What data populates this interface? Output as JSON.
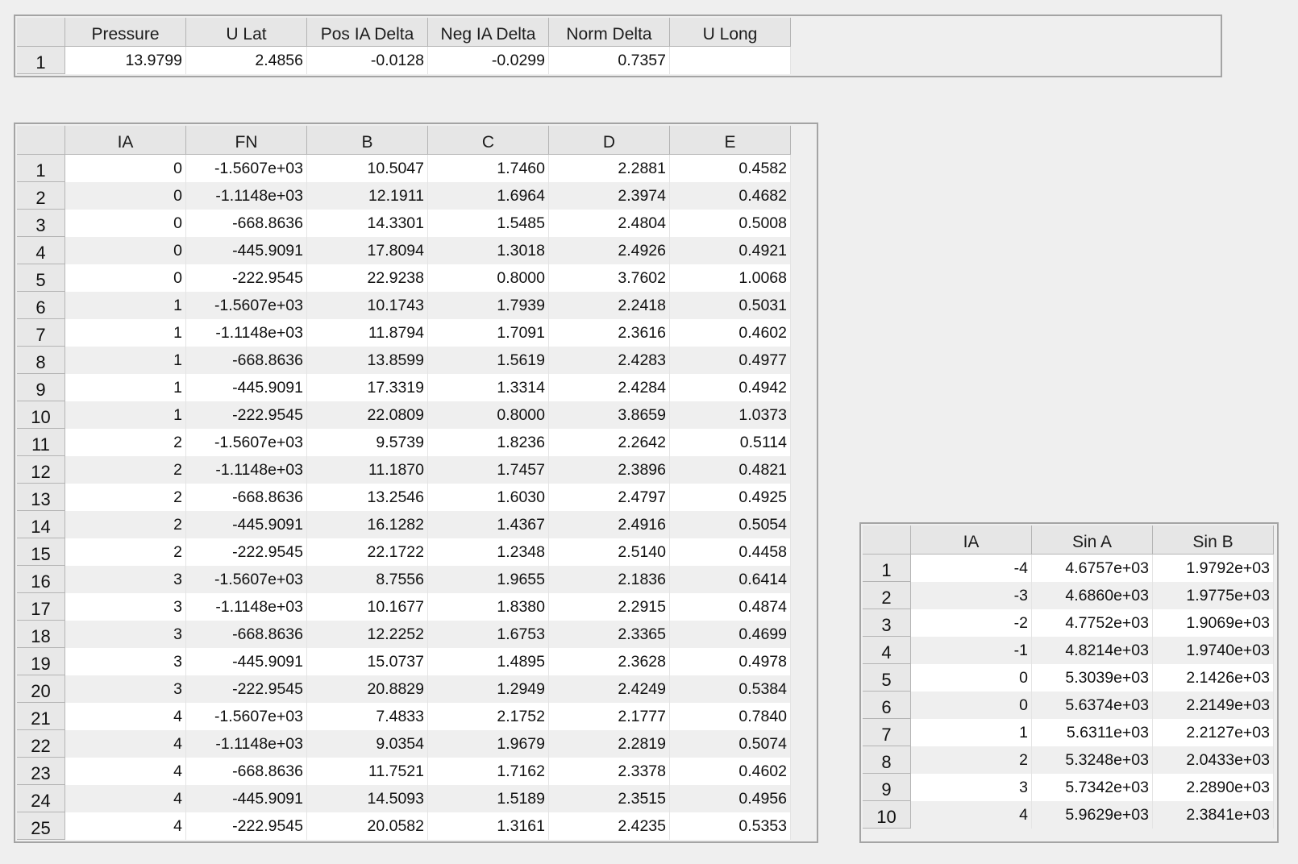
{
  "summary_table": {
    "columns": [
      "Pressure",
      "U Lat",
      "Pos IA Delta",
      "Neg IA Delta",
      "Norm Delta",
      "U Long"
    ],
    "rows": [
      {
        "index": "1",
        "cells": [
          "13.9799",
          "2.4856",
          "-0.0128",
          "-0.0299",
          "0.7357",
          ""
        ]
      }
    ]
  },
  "fit_table": {
    "columns": [
      "IA",
      "FN",
      "B",
      "C",
      "D",
      "E"
    ],
    "rows": [
      {
        "index": "1",
        "cells": [
          "0",
          "-1.5607e+03",
          "10.5047",
          "1.7460",
          "2.2881",
          "0.4582"
        ]
      },
      {
        "index": "2",
        "cells": [
          "0",
          "-1.1148e+03",
          "12.1911",
          "1.6964",
          "2.3974",
          "0.4682"
        ]
      },
      {
        "index": "3",
        "cells": [
          "0",
          "-668.8636",
          "14.3301",
          "1.5485",
          "2.4804",
          "0.5008"
        ]
      },
      {
        "index": "4",
        "cells": [
          "0",
          "-445.9091",
          "17.8094",
          "1.3018",
          "2.4926",
          "0.4921"
        ]
      },
      {
        "index": "5",
        "cells": [
          "0",
          "-222.9545",
          "22.9238",
          "0.8000",
          "3.7602",
          "1.0068"
        ]
      },
      {
        "index": "6",
        "cells": [
          "1",
          "-1.5607e+03",
          "10.1743",
          "1.7939",
          "2.2418",
          "0.5031"
        ]
      },
      {
        "index": "7",
        "cells": [
          "1",
          "-1.1148e+03",
          "11.8794",
          "1.7091",
          "2.3616",
          "0.4602"
        ]
      },
      {
        "index": "8",
        "cells": [
          "1",
          "-668.8636",
          "13.8599",
          "1.5619",
          "2.4283",
          "0.4977"
        ]
      },
      {
        "index": "9",
        "cells": [
          "1",
          "-445.9091",
          "17.3319",
          "1.3314",
          "2.4284",
          "0.4942"
        ]
      },
      {
        "index": "10",
        "cells": [
          "1",
          "-222.9545",
          "22.0809",
          "0.8000",
          "3.8659",
          "1.0373"
        ]
      },
      {
        "index": "11",
        "cells": [
          "2",
          "-1.5607e+03",
          "9.5739",
          "1.8236",
          "2.2642",
          "0.5114"
        ]
      },
      {
        "index": "12",
        "cells": [
          "2",
          "-1.1148e+03",
          "11.1870",
          "1.7457",
          "2.3896",
          "0.4821"
        ]
      },
      {
        "index": "13",
        "cells": [
          "2",
          "-668.8636",
          "13.2546",
          "1.6030",
          "2.4797",
          "0.4925"
        ]
      },
      {
        "index": "14",
        "cells": [
          "2",
          "-445.9091",
          "16.1282",
          "1.4367",
          "2.4916",
          "0.5054"
        ]
      },
      {
        "index": "15",
        "cells": [
          "2",
          "-222.9545",
          "22.1722",
          "1.2348",
          "2.5140",
          "0.4458"
        ]
      },
      {
        "index": "16",
        "cells": [
          "3",
          "-1.5607e+03",
          "8.7556",
          "1.9655",
          "2.1836",
          "0.6414"
        ]
      },
      {
        "index": "17",
        "cells": [
          "3",
          "-1.1148e+03",
          "10.1677",
          "1.8380",
          "2.2915",
          "0.4874"
        ]
      },
      {
        "index": "18",
        "cells": [
          "3",
          "-668.8636",
          "12.2252",
          "1.6753",
          "2.3365",
          "0.4699"
        ]
      },
      {
        "index": "19",
        "cells": [
          "3",
          "-445.9091",
          "15.0737",
          "1.4895",
          "2.3628",
          "0.4978"
        ]
      },
      {
        "index": "20",
        "cells": [
          "3",
          "-222.9545",
          "20.8829",
          "1.2949",
          "2.4249",
          "0.5384"
        ]
      },
      {
        "index": "21",
        "cells": [
          "4",
          "-1.5607e+03",
          "7.4833",
          "2.1752",
          "2.1777",
          "0.7840"
        ]
      },
      {
        "index": "22",
        "cells": [
          "4",
          "-1.1148e+03",
          "9.0354",
          "1.9679",
          "2.2819",
          "0.5074"
        ]
      },
      {
        "index": "23",
        "cells": [
          "4",
          "-668.8636",
          "11.7521",
          "1.7162",
          "2.3378",
          "0.4602"
        ]
      },
      {
        "index": "24",
        "cells": [
          "4",
          "-445.9091",
          "14.5093",
          "1.5189",
          "2.3515",
          "0.4956"
        ]
      },
      {
        "index": "25",
        "cells": [
          "4",
          "-222.9545",
          "20.0582",
          "1.3161",
          "2.4235",
          "0.5353"
        ]
      }
    ]
  },
  "sin_table": {
    "columns": [
      "IA",
      "Sin A",
      "Sin B"
    ],
    "rows": [
      {
        "index": "1",
        "cells": [
          "-4",
          "4.6757e+03",
          "1.9792e+03"
        ]
      },
      {
        "index": "2",
        "cells": [
          "-3",
          "4.6860e+03",
          "1.9775e+03"
        ]
      },
      {
        "index": "3",
        "cells": [
          "-2",
          "4.7752e+03",
          "1.9069e+03"
        ]
      },
      {
        "index": "4",
        "cells": [
          "-1",
          "4.8214e+03",
          "1.9740e+03"
        ]
      },
      {
        "index": "5",
        "cells": [
          "0",
          "5.3039e+03",
          "2.1426e+03"
        ]
      },
      {
        "index": "6",
        "cells": [
          "0",
          "5.6374e+03",
          "2.2149e+03"
        ]
      },
      {
        "index": "7",
        "cells": [
          "1",
          "5.6311e+03",
          "2.2127e+03"
        ]
      },
      {
        "index": "8",
        "cells": [
          "2",
          "5.3248e+03",
          "2.0433e+03"
        ]
      },
      {
        "index": "9",
        "cells": [
          "3",
          "5.7342e+03",
          "2.2890e+03"
        ]
      },
      {
        "index": "10",
        "cells": [
          "4",
          "5.9629e+03",
          "2.3841e+03"
        ]
      }
    ]
  }
}
